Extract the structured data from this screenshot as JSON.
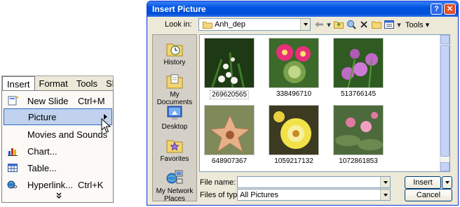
{
  "menubar": {
    "items": [
      {
        "label": "Insert"
      },
      {
        "label": "Format"
      },
      {
        "label": "Tools"
      },
      {
        "label": "Sli"
      }
    ]
  },
  "insert_menu": {
    "items": [
      {
        "label": "New Slide",
        "shortcut": "Ctrl+M",
        "icon": "new-slide-icon"
      },
      {
        "label": "Picture",
        "shortcut": "",
        "icon": "",
        "submenu": true,
        "highlighted": true
      },
      {
        "label": "Movies and Sounds",
        "shortcut": "",
        "icon": ""
      },
      {
        "label": "Chart...",
        "shortcut": "",
        "icon": "chart-icon"
      },
      {
        "label": "Table...",
        "shortcut": "",
        "icon": "table-icon"
      },
      {
        "label": "Hyperlink...",
        "shortcut": "Ctrl+K",
        "icon": "hyperlink-icon"
      }
    ],
    "more": "»"
  },
  "dialog": {
    "title": "Insert Picture",
    "help_button": "?",
    "close_button": "✕",
    "look_in_label": "Look in:",
    "look_in_value": "Anh_dep",
    "tools_label": "Tools",
    "places": [
      {
        "label": "History",
        "icon": "history-icon"
      },
      {
        "label": "My Documents",
        "icon": "my-documents-icon"
      },
      {
        "label": "Desktop",
        "icon": "desktop-icon"
      },
      {
        "label": "Favorites",
        "icon": "favorites-icon"
      },
      {
        "label": "My Network Places",
        "icon": "network-places-icon"
      }
    ],
    "files": [
      {
        "name": "269620565",
        "selected": true,
        "colors": [
          "#1e3a14",
          "#f4f4f0"
        ]
      },
      {
        "name": "338496710",
        "selected": false,
        "colors": [
          "#3b6a2a",
          "#e8307a"
        ]
      },
      {
        "name": "513766145",
        "selected": false,
        "colors": [
          "#2f5a22",
          "#c06ac8"
        ]
      },
      {
        "name": "648907367",
        "selected": false,
        "colors": [
          "#7e8a5a",
          "#e6b089"
        ]
      },
      {
        "name": "1059217132",
        "selected": false,
        "colors": [
          "#3c3a20",
          "#f2e24a"
        ]
      },
      {
        "name": "1072861853",
        "selected": false,
        "colors": [
          "#4d6a3c",
          "#e07aa0"
        ]
      }
    ],
    "file_name_label": "File name:",
    "file_name_value": "",
    "file_type_label": "Files of type:",
    "file_type_value": "All Pictures",
    "insert_button": "Insert",
    "cancel_button": "Cancel"
  }
}
